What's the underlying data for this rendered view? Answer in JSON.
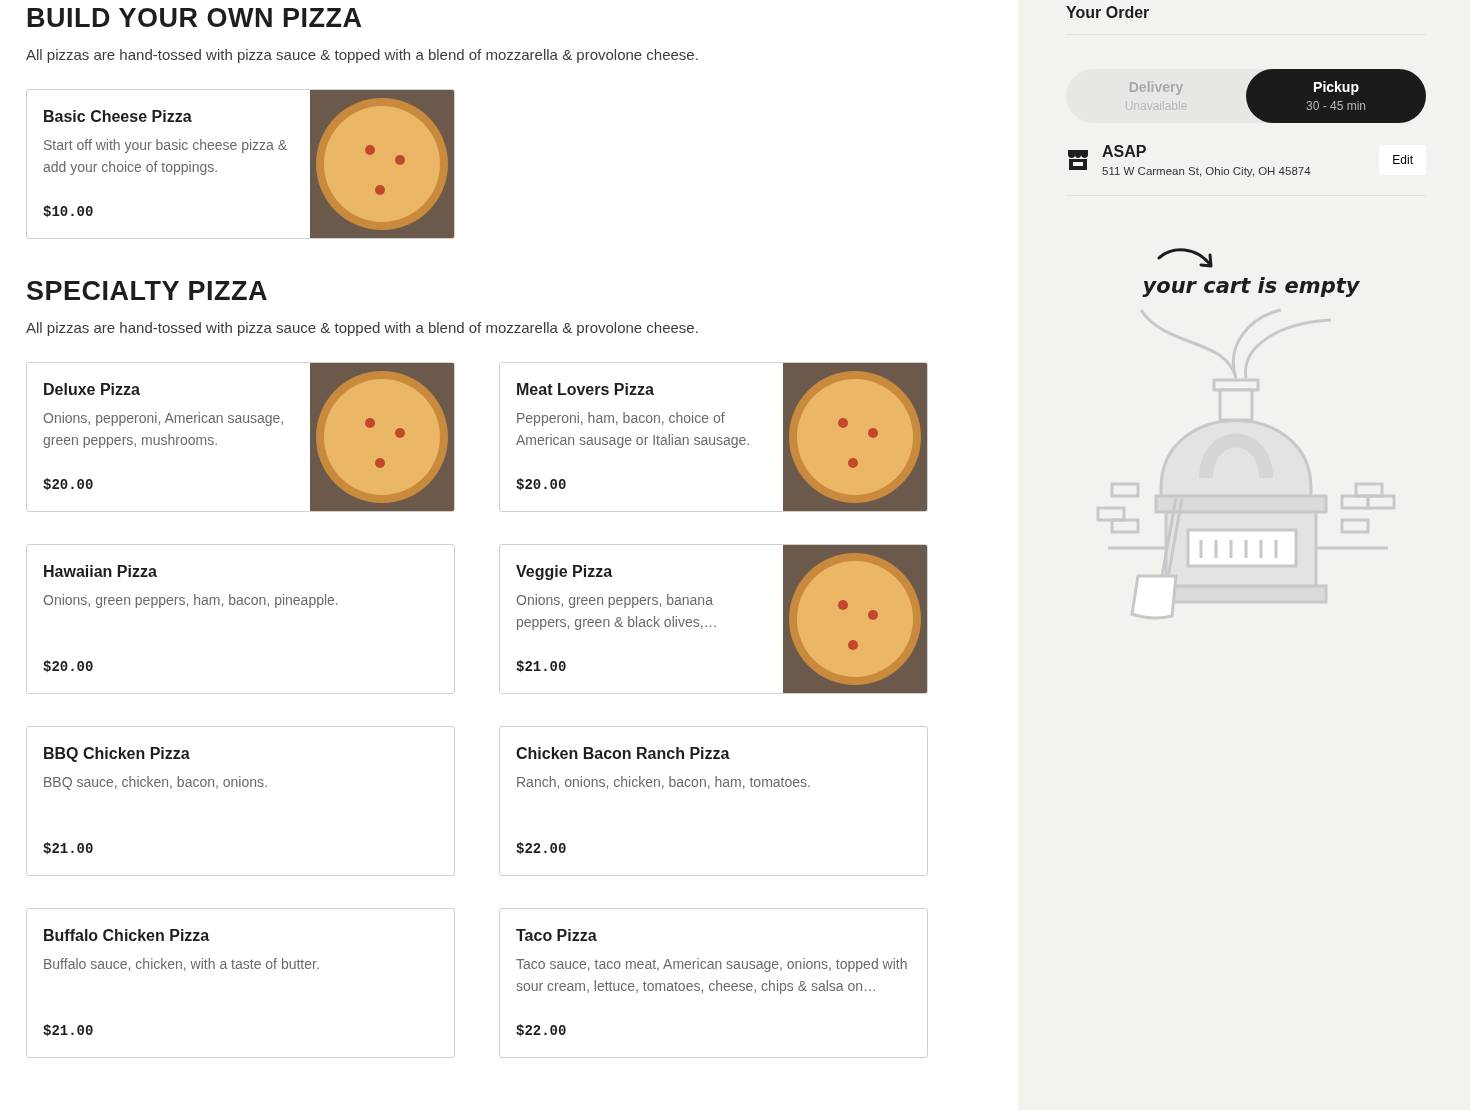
{
  "sections": [
    {
      "title": "BUILD YOUR OWN PIZZA",
      "description": "All pizzas are hand-tossed with pizza sauce & topped with a blend of mozzarella & provolone cheese.",
      "items": [
        {
          "name": "Basic Cheese Pizza",
          "description": "Start off with your basic cheese pizza & add your choice of toppings.",
          "price": "$10.00",
          "photo": true
        }
      ]
    },
    {
      "title": "SPECIALTY PIZZA",
      "description": "All pizzas are hand-tossed with pizza sauce & topped with a blend of mozzarella & provolone cheese.",
      "items": [
        {
          "name": "Deluxe Pizza",
          "description": "Onions, pepperoni, American sausage, green peppers, mushrooms.",
          "price": "$20.00",
          "photo": true
        },
        {
          "name": "Meat Lovers Pizza",
          "description": "Pepperoni, ham, bacon, choice of American sausage or Italian sausage.",
          "price": "$20.00",
          "photo": true
        },
        {
          "name": "Hawaiian Pizza",
          "description": "Onions, green peppers, ham, bacon, pineapple.",
          "price": "$20.00",
          "photo": false
        },
        {
          "name": "Veggie Pizza",
          "description": "Onions, green peppers, banana peppers, green & black olives,…",
          "price": "$21.00",
          "photo": true
        },
        {
          "name": "BBQ Chicken Pizza",
          "description": "BBQ sauce, chicken, bacon, onions.",
          "price": "$21.00",
          "photo": false
        },
        {
          "name": "Chicken Bacon Ranch Pizza",
          "description": "Ranch, onions, chicken, bacon, ham, tomatoes.",
          "price": "$22.00",
          "photo": false
        },
        {
          "name": "Buffalo Chicken Pizza",
          "description": "Buffalo sauce, chicken, with a taste of butter.",
          "price": "$21.00",
          "photo": false
        },
        {
          "name": "Taco Pizza",
          "description": "Taco sauce, taco meat, American sausage, onions, topped with sour cream, lettuce, tomatoes, cheese, chips & salsa on…",
          "price": "$22.00",
          "photo": false
        }
      ]
    }
  ],
  "order": {
    "title": "Your Order",
    "modes": [
      {
        "label": "Delivery",
        "sublabel": "Unavailable",
        "selected": false,
        "disabled": true
      },
      {
        "label": "Pickup",
        "sublabel": "30 - 45 min",
        "selected": true,
        "disabled": false
      }
    ],
    "time": "ASAP",
    "address": "511 W Carmean St, Ohio City, OH 45874",
    "edit": "Edit",
    "empty_message": "your cart is empty"
  }
}
